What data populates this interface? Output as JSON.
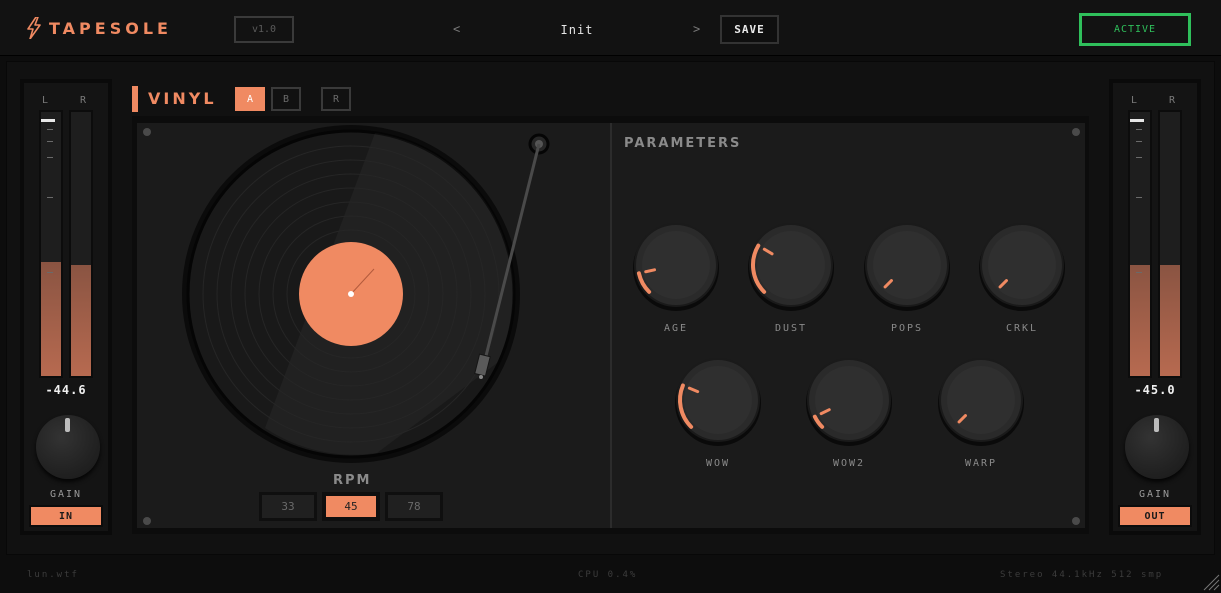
{
  "header": {
    "logo_text": "TAPESOLE",
    "version": "v1.0",
    "prev_label": "<",
    "next_label": ">",
    "preset_name": "Init",
    "save_label": "SAVE",
    "active_label": "ACTIVE"
  },
  "colors": {
    "accent": "#f08a62",
    "active_green": "#2fbf5b",
    "meter_fill": "#b76a50"
  },
  "input_meter": {
    "l_label": "L",
    "r_label": "R",
    "value": "-44.6",
    "level_l": 0.43,
    "level_r": 0.42,
    "gain_label": "GAIN",
    "io_label": "IN"
  },
  "output_meter": {
    "l_label": "L",
    "r_label": "R",
    "value": "-45.0",
    "level_l": 0.42,
    "level_r": 0.42,
    "gain_label": "GAIN",
    "io_label": "OUT"
  },
  "module": {
    "title": "VINYL",
    "slot_a": "A",
    "slot_b": "B",
    "reset": "R",
    "rpm_label": "RPM",
    "rpm_options": [
      "33",
      "45",
      "78"
    ],
    "rpm_selected": "45",
    "params_title": "PARAMETERS",
    "knobs": [
      {
        "label": "AGE",
        "value": 0.12
      },
      {
        "label": "DUST",
        "value": 0.28
      },
      {
        "label": "POPS",
        "value": 0.0
      },
      {
        "label": "CRKL",
        "value": 0.0
      },
      {
        "label": "WOW",
        "value": 0.25
      },
      {
        "label": "WOW2",
        "value": 0.07
      },
      {
        "label": "WARP",
        "value": 0.0
      }
    ]
  },
  "footer": {
    "brand": "lun.wtf",
    "cpu": "CPU 0.4%",
    "format": "Stereo  44.1kHz  512 smp"
  }
}
